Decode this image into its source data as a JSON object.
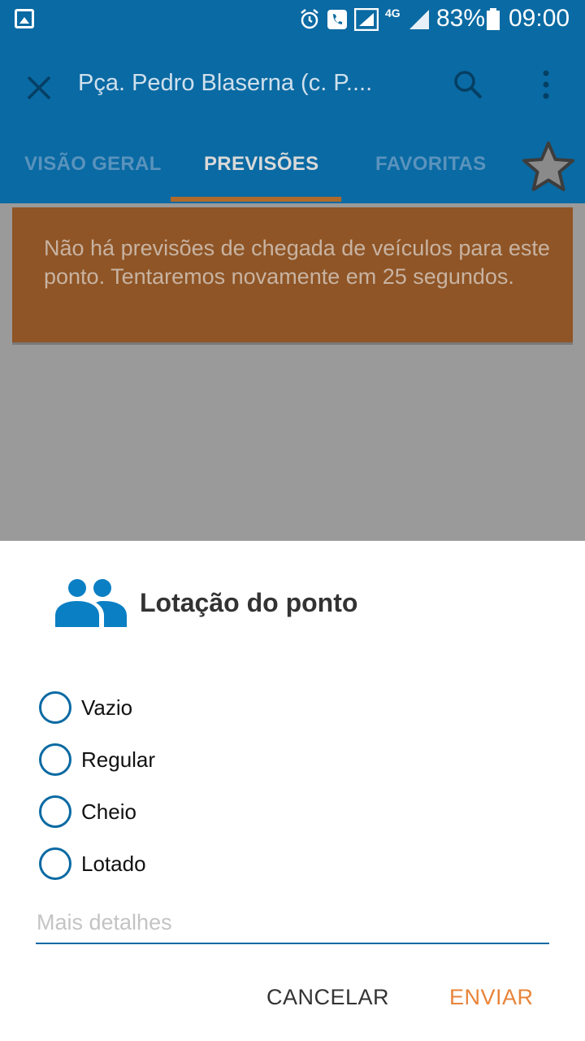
{
  "status_bar": {
    "battery": "83%",
    "time": "09:00",
    "network": "4G"
  },
  "app_bar": {
    "title": "Pça. Pedro Blaserna (c. P...."
  },
  "tabs": [
    {
      "label": "VISÃO GERAL"
    },
    {
      "label": "PREVISÕES"
    },
    {
      "label": "FAVORITAS"
    }
  ],
  "banner": {
    "message": "Não há previsões de chegada de veículos para este ponto. Tentaremos novamente em 25 segundos."
  },
  "dialog": {
    "title": "Lotação do ponto",
    "options": [
      {
        "label": "Vazio"
      },
      {
        "label": "Regular"
      },
      {
        "label": "Cheio"
      },
      {
        "label": "Lotado"
      }
    ],
    "details_placeholder": "Mais detalhes",
    "cancel_label": "CANCELAR",
    "send_label": "ENVIAR"
  },
  "colors": {
    "primary": "#0a6aa3",
    "accent": "#e8843a",
    "banner": "#8f5526"
  }
}
